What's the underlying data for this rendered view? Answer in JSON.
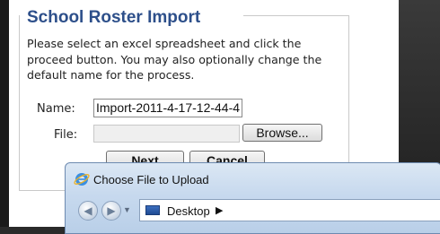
{
  "form": {
    "legend": "School Roster Import",
    "instructions": "Please select an excel spreadsheet and click the proceed button. You may also optionally change the default name for the process.",
    "name_label": "Name:",
    "name_value": "Import-2011-4-17-12-44-4",
    "file_label": "File:",
    "file_value": "",
    "browse_label": "Browse...",
    "next_label": "Next",
    "cancel_label": "Cancel"
  },
  "dialog": {
    "title": "Choose File to Upload",
    "location": "Desktop",
    "title_icon": "ie-logo-icon",
    "location_icon": "desktop-icon"
  },
  "colors": {
    "legend": "#2d4f8a",
    "dialog_frame": "#c7d9ee"
  }
}
